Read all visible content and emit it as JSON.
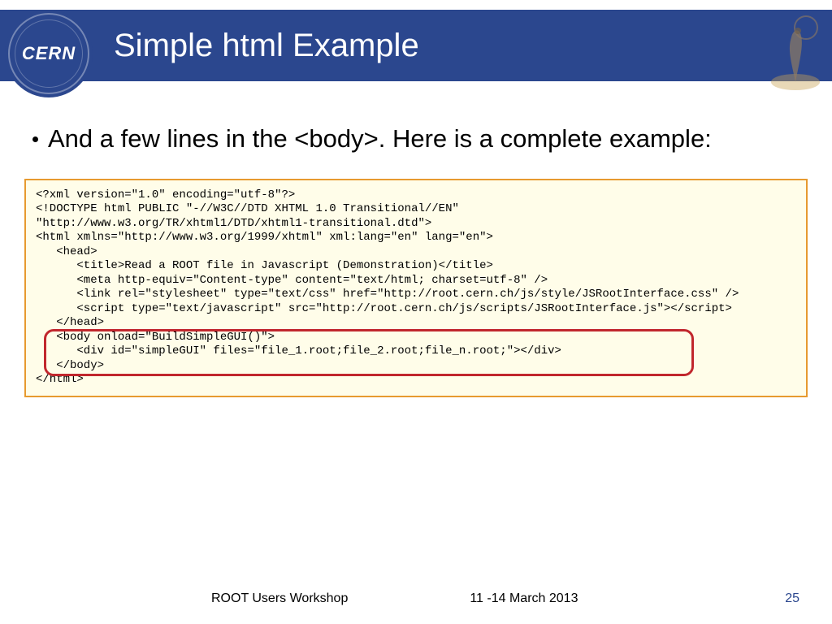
{
  "header": {
    "logo_text": "CERN",
    "title": "Simple html Example"
  },
  "bullet": {
    "text": "And a few lines in the <body>. Here is a complete example:"
  },
  "code": {
    "l1": "<?xml version=\"1.0\" encoding=\"utf-8\"?>",
    "l2": "<!DOCTYPE html PUBLIC \"-//W3C//DTD XHTML 1.0 Transitional//EN\"",
    "l3": "\"http://www.w3.org/TR/xhtml1/DTD/xhtml1-transitional.dtd\">",
    "l4": "<html xmlns=\"http://www.w3.org/1999/xhtml\" xml:lang=\"en\" lang=\"en\">",
    "l5": "   <head>",
    "l6": "      <title>Read a ROOT file in Javascript (Demonstration)</title>",
    "l7": "      <meta http-equiv=\"Content-type\" content=\"text/html; charset=utf-8\" />",
    "l8": "      <link rel=\"stylesheet\" type=\"text/css\" href=\"http://root.cern.ch/js/style/JSRootInterface.css\" />",
    "l9": "      <script type=\"text/javascript\" src=\"http://root.cern.ch/js/scripts/JSRootInterface.js\"></script>",
    "l10": "   </head>",
    "l11": "   <body onload=\"BuildSimpleGUI()\">",
    "l12": "      <div id=\"simpleGUI\" files=\"file_1.root;file_2.root;file_n.root;\"></div>",
    "l13": "   </body>",
    "l14": "</html>"
  },
  "footer": {
    "workshop": "ROOT Users Workshop",
    "date": "11 -14 March 2013",
    "slide_number": "25"
  }
}
